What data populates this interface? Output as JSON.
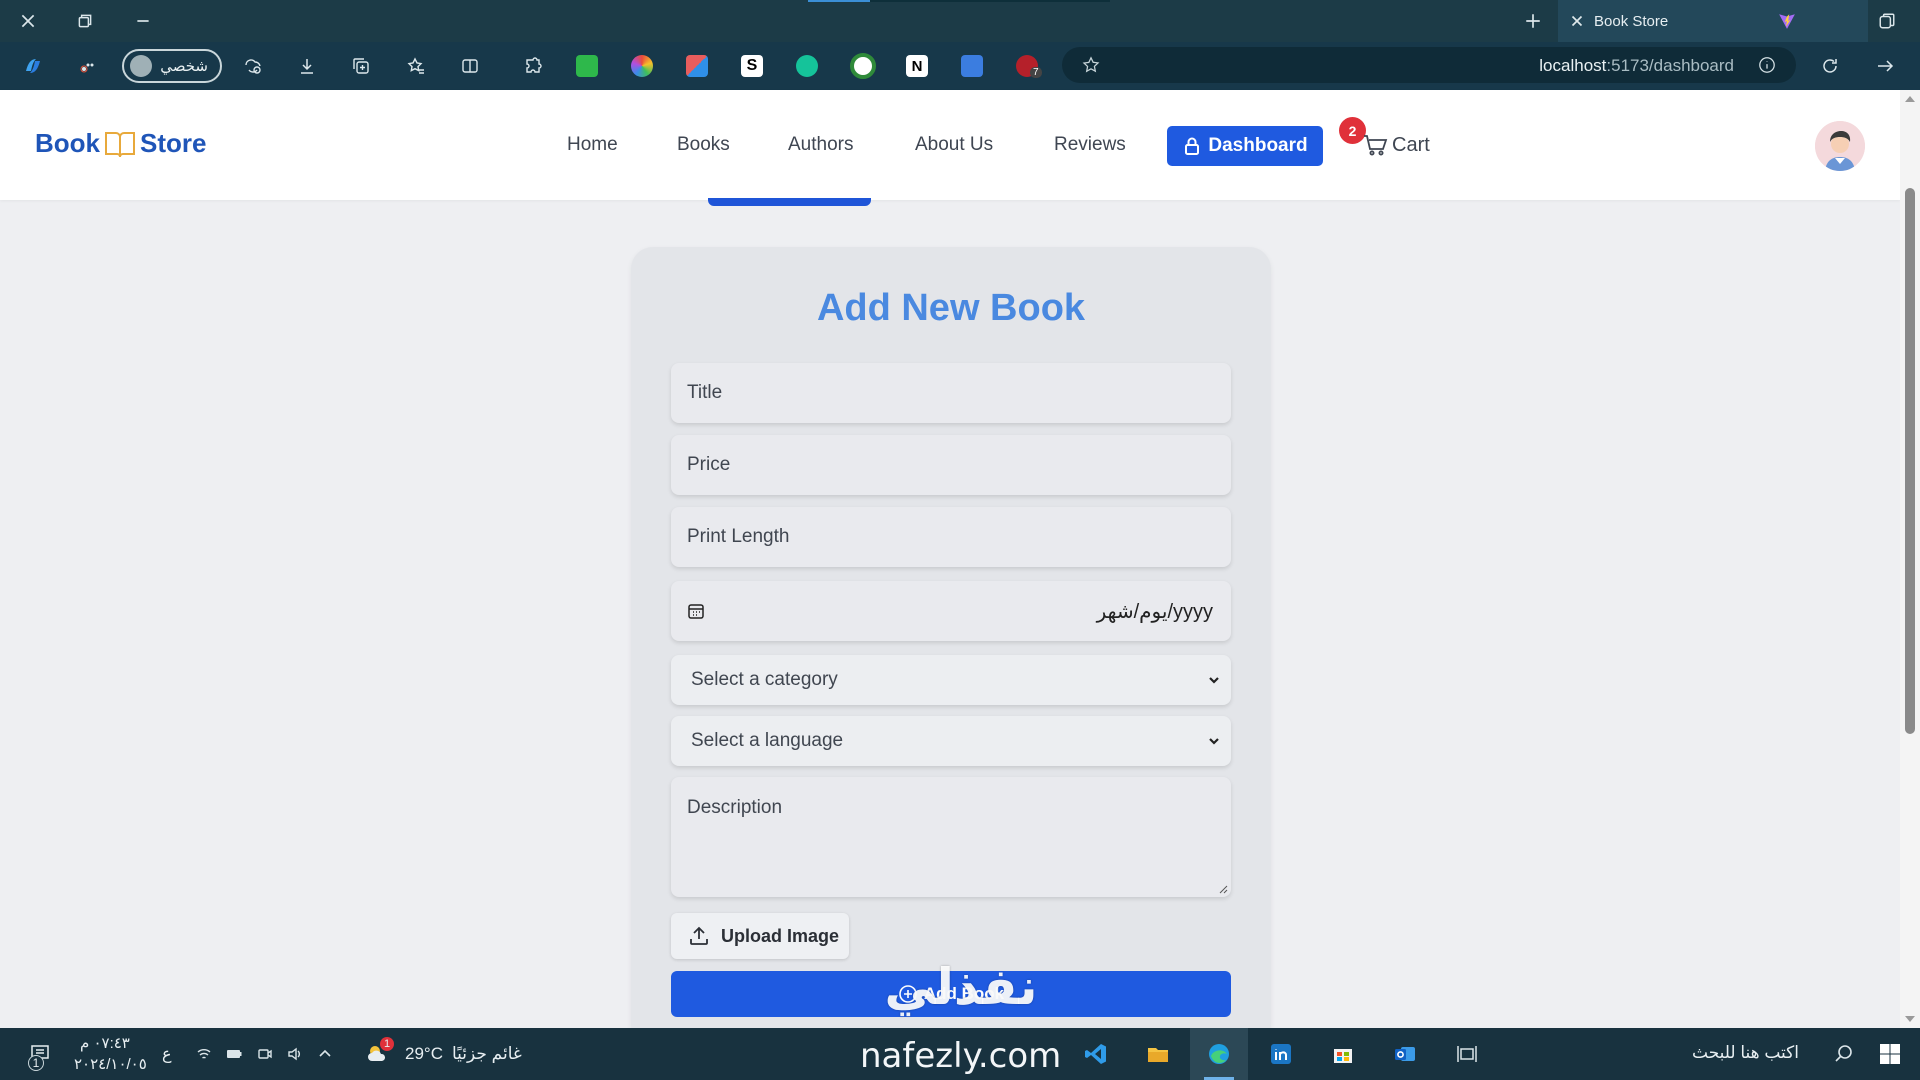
{
  "browser": {
    "tab_title": "Book Store",
    "profile_label": "شخصي",
    "url_host": "localhost",
    "url_path": ":5173/dashboard",
    "extension_badge": "7"
  },
  "navbar": {
    "logo_part1": "Book",
    "logo_part2": "Store",
    "links": [
      "Home",
      "Books",
      "Authors",
      "About Us",
      "Reviews"
    ],
    "dashboard_label": "Dashboard",
    "cart_label": "Cart",
    "cart_count": "2"
  },
  "form": {
    "heading": "Add New Book",
    "title_placeholder": "Title",
    "price_placeholder": "Price",
    "print_length_placeholder": "Print Length",
    "date_placeholder": "يوم/شهر/yyyy",
    "category_select": "Select a category",
    "language_select": "Select a language",
    "description_placeholder": "Description",
    "upload_label": "Upload Image",
    "submit_label": "Add Book"
  },
  "watermark": {
    "arabic": "نفذلي",
    "latin": "nafezly.com"
  },
  "taskbar": {
    "time": "٠٧:٤٣ م",
    "date": "٢٠٢٤/١٠/٠٥",
    "input_lang": "ع",
    "weather_temp": "29°C",
    "weather_desc": "غائم جزئيًا",
    "weather_badge": "1",
    "search_placeholder": "اكتب هنا للبحث",
    "notif_badge": "1"
  },
  "colors": {
    "brand_blue": "#1f5ae0",
    "heading_blue": "#4a89e0",
    "cart_badge": "#e0313a",
    "browser_chrome": "#17384a"
  }
}
